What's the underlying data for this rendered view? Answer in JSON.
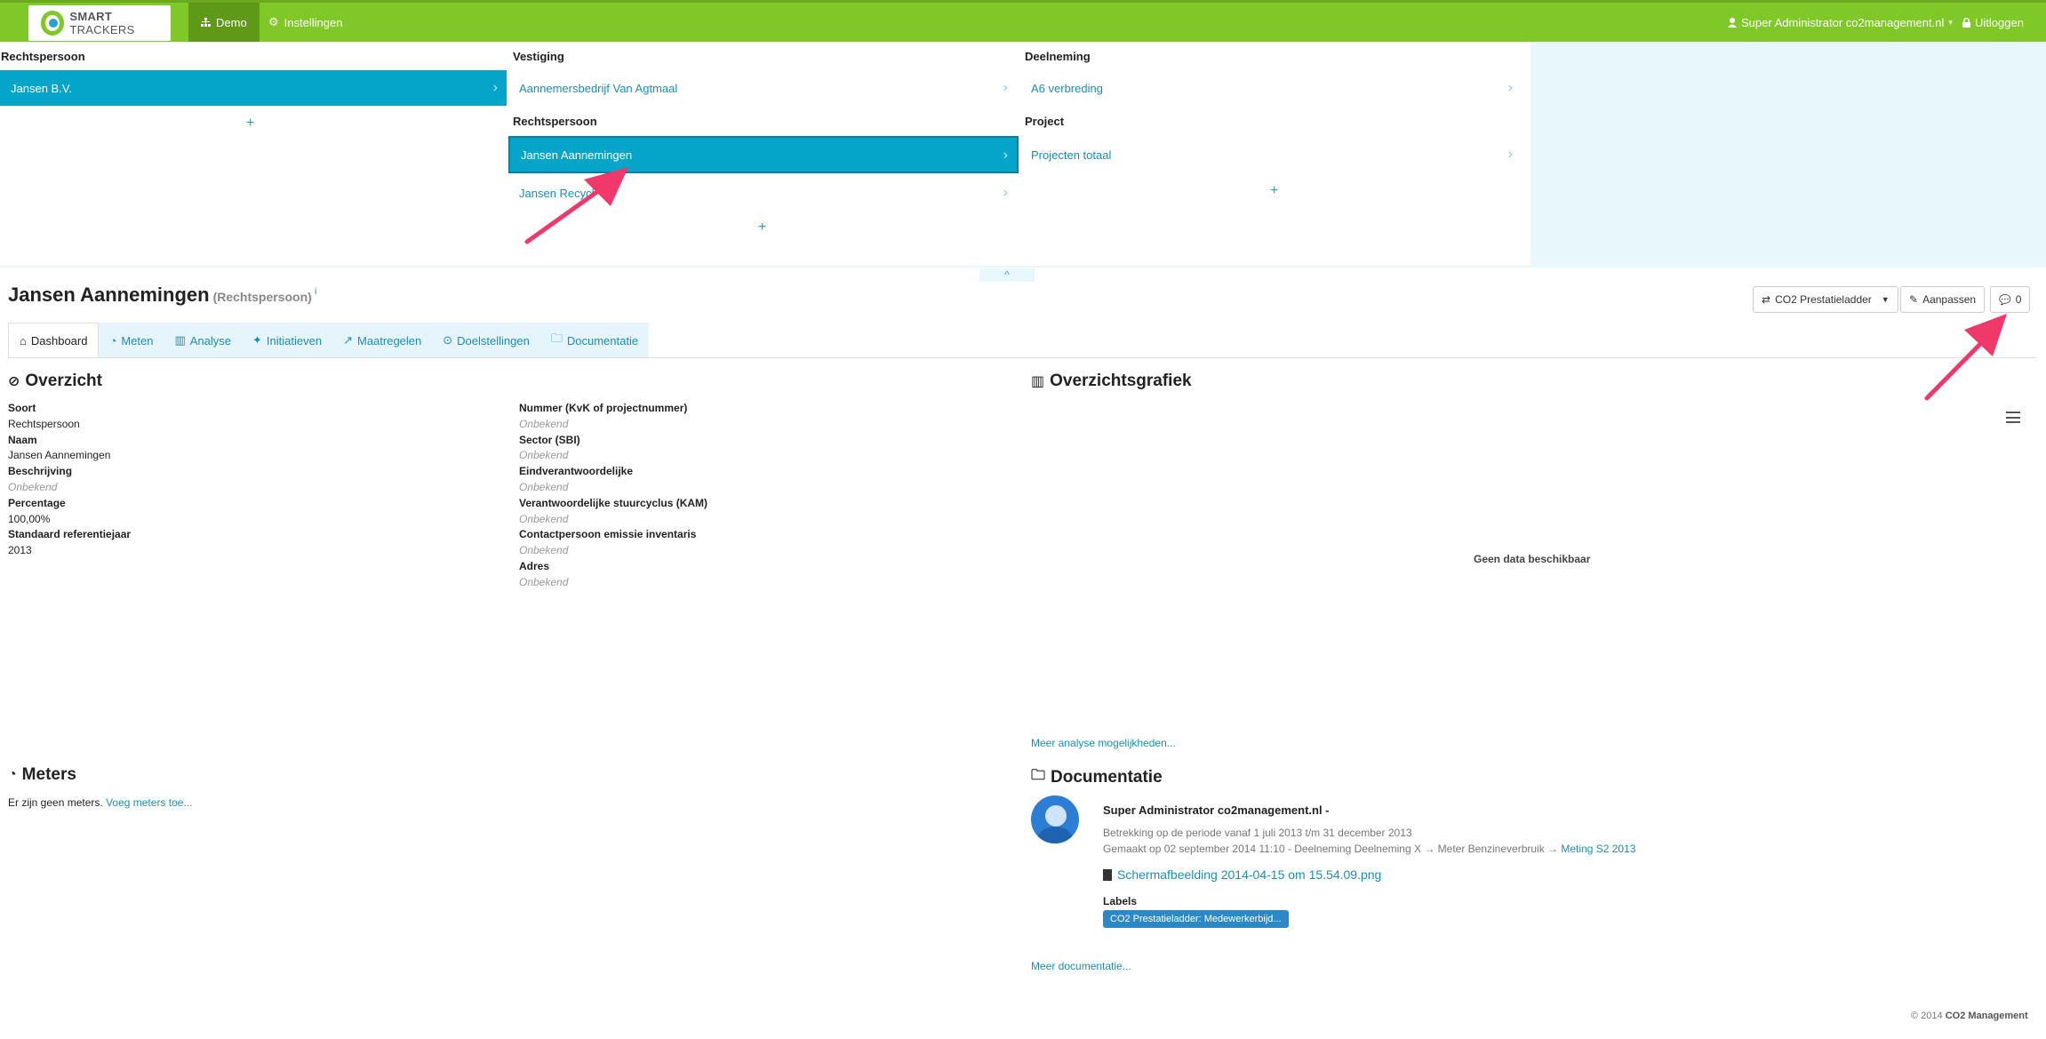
{
  "nav": {
    "logo_bold": "SMART",
    "logo_rest": "TRACKERS",
    "demo_label": "Demo",
    "settings_label": "Instellingen",
    "user_label": "Super Administrator co2management.nl",
    "logout_label": "Uitloggen"
  },
  "selector": {
    "col1": {
      "heading": "Rechtspersoon",
      "items": [
        "Jansen B.V."
      ]
    },
    "col2": {
      "heading1": "Vestiging",
      "items1": [
        "Aannemersbedrijf Van Agtmaal"
      ],
      "heading2": "Rechtspersoon",
      "items2": [
        "Jansen Aannemingen",
        "Jansen Recycl"
      ]
    },
    "col3": {
      "heading1": "Deelneming",
      "items1": [
        "A6 verbreding"
      ],
      "heading2": "Project",
      "items2": [
        "Projecten totaal"
      ]
    },
    "plus": "+",
    "chevron": "›",
    "collapse": "^"
  },
  "entity": {
    "title": "Jansen Aannemingen",
    "subtitle": "(Rechtspersoon)",
    "info": "i",
    "btn_ladder": "CO2 Prestatieladder",
    "btn_edit": "Aanpassen",
    "btn_comments": "0"
  },
  "tabs": [
    "Dashboard",
    "Meten",
    "Analyse",
    "Initiatieven",
    "Maatregelen",
    "Doelstellingen",
    "Documentatie"
  ],
  "overview": {
    "heading": "Overzicht",
    "left": [
      {
        "k": "Soort",
        "v": "Rechtspersoon",
        "unknown": false
      },
      {
        "k": "Naam",
        "v": "Jansen Aannemingen",
        "unknown": false
      },
      {
        "k": "Beschrijving",
        "v": "Onbekend",
        "unknown": true
      },
      {
        "k": "Percentage",
        "v": "100,00%",
        "unknown": false
      },
      {
        "k": "Standaard referentiejaar",
        "v": "2013",
        "unknown": false
      }
    ],
    "right": [
      {
        "k": "Nummer (KvK of projectnummer)",
        "v": "Onbekend",
        "unknown": true
      },
      {
        "k": "Sector (SBI)",
        "v": "Onbekend",
        "unknown": true
      },
      {
        "k": "Eindverantwoordelijke",
        "v": "Onbekend",
        "unknown": true
      },
      {
        "k": "Verantwoordelijke stuurcyclus (KAM)",
        "v": "Onbekend",
        "unknown": true
      },
      {
        "k": "Contactpersoon emissie inventaris",
        "v": "Onbekend",
        "unknown": true
      },
      {
        "k": "Adres",
        "v": "Onbekend",
        "unknown": true
      }
    ]
  },
  "chart": {
    "heading": "Overzichtsgrafiek",
    "no_data": "Geen data beschikbaar",
    "more_link": "Meer analyse mogelijkheden..."
  },
  "meters": {
    "heading": "Meters",
    "empty_text": "Er zijn geen meters.",
    "add_link": "Voeg meters toe..."
  },
  "docs": {
    "heading": "Documentatie",
    "author": "Super Administrator co2management.nl -",
    "period": "Betrekking op de periode vanaf 1 juli 2013 t/m 31 december 2013",
    "created": "Gemaakt op 02 september 2014 11:10 - Deelneming Deelneming X → Meter Benzineverbruik →",
    "created_link": "Meting S2 2013",
    "file": "Schermafbeelding 2014-04-15 om 15.54.09.png",
    "labels_heading": "Labels",
    "label": "CO2 Prestatieladder: Medewerkerbijd...",
    "more_link": "Meer documentatie..."
  },
  "footer": {
    "year": "© 2014",
    "org": "CO2 Management"
  },
  "colors": {
    "nav_green": "#80c828",
    "active_blue": "#04a5c8",
    "arrow_pink": "#f0386b"
  }
}
